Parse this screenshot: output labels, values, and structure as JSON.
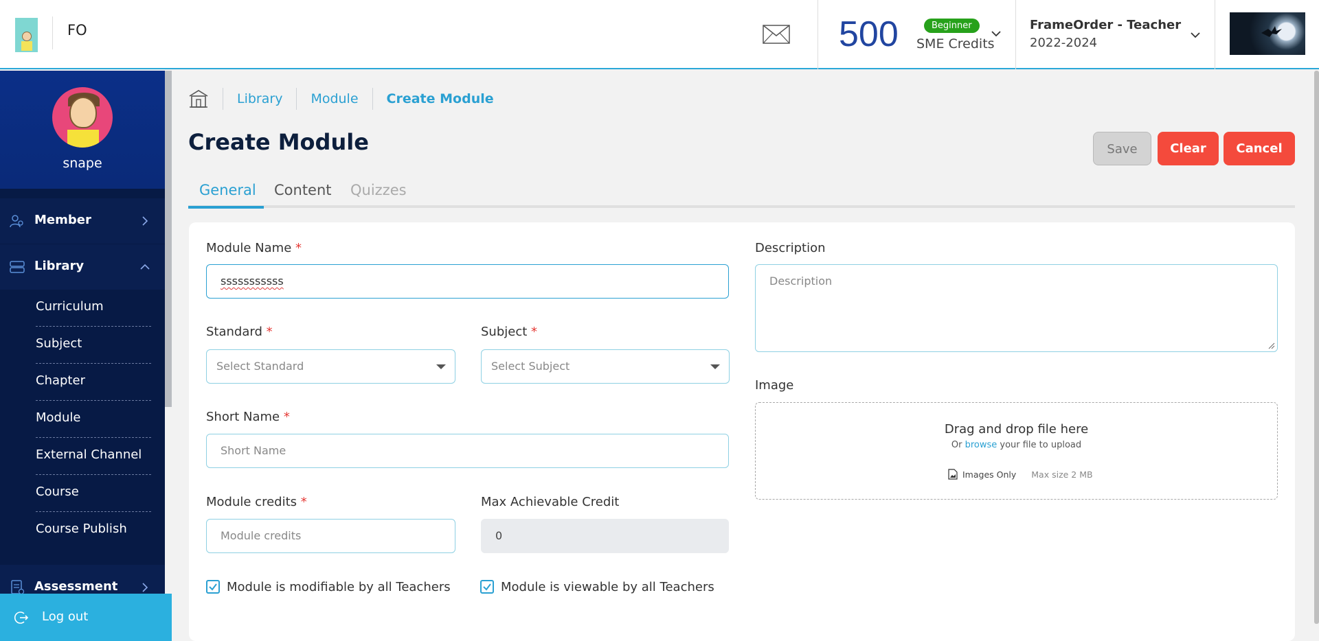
{
  "header": {
    "brand": "FO",
    "credits_value": "500",
    "level_badge": "Beginner",
    "credits_label": "SME Credits",
    "org_title": "FrameOrder - Teacher",
    "org_year": "2022-2024"
  },
  "sidebar": {
    "username": "snape",
    "member_label": "Member",
    "library_label": "Library",
    "library_items": [
      "Curriculum",
      "Subject",
      "Chapter",
      "Module",
      "External Channel",
      "Course",
      "Course Publish"
    ],
    "assessment_label": "Assessment",
    "logout_label": "Log out"
  },
  "breadcrumb": {
    "items": [
      "Library",
      "Module",
      "Create Module"
    ]
  },
  "page": {
    "title": "Create Module",
    "save_label": "Save",
    "clear_label": "Clear",
    "cancel_label": "Cancel"
  },
  "tabs": [
    "General",
    "Content",
    "Quizzes"
  ],
  "form": {
    "module_name_label": "Module Name",
    "module_name_value": "sssssssssss",
    "standard_label": "Standard",
    "standard_placeholder": "Select Standard",
    "subject_label": "Subject",
    "subject_placeholder": "Select Subject",
    "short_name_label": "Short Name",
    "short_name_placeholder": "Short Name",
    "module_credits_label": "Module credits",
    "module_credits_placeholder": "Module credits",
    "max_credit_label": "Max Achievable Credit",
    "max_credit_value": "0",
    "description_label": "Description",
    "description_placeholder": "Description",
    "image_label": "Image",
    "required_mark": "*",
    "dropzone": {
      "title": "Drag and drop file here",
      "sub_prefix": "Or",
      "sub_link": "browse",
      "sub_suffix": "your file to upload",
      "images_only": "Images Only",
      "max_size": "Max size 2 MB"
    },
    "check_modifiable_label": "Module is modifiable by all Teachers",
    "check_viewable_label": "Module is viewable by all Teachers",
    "check_modifiable": true,
    "check_viewable": true
  },
  "colors": {
    "accent": "#2aa0d2",
    "danger": "#f44a3c",
    "sidebar": "#071a45",
    "badge": "#27a11b",
    "credits": "#2145a0"
  }
}
